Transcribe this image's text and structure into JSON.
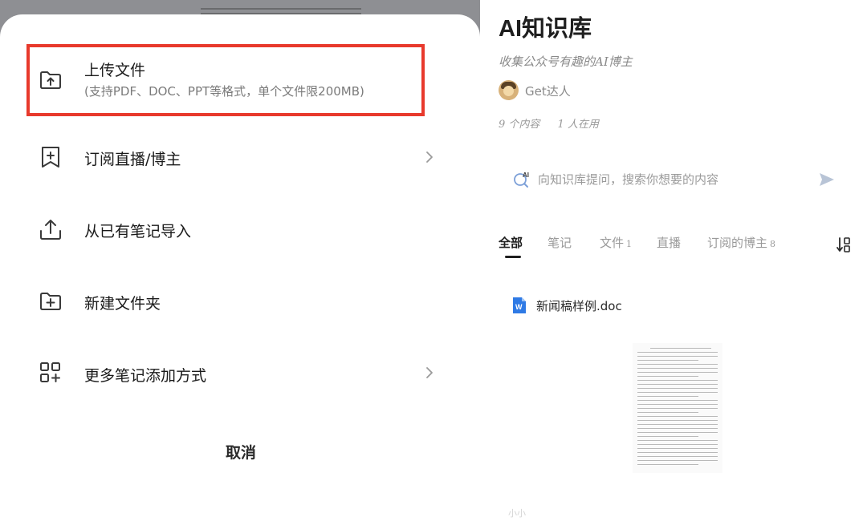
{
  "upload_sheet": {
    "items": [
      {
        "label": "上传文件",
        "sublabel": "(支持PDF、DOC、PPT等格式，单个文件限200MB)",
        "icon": "upload-folder-icon",
        "highlighted": true
      },
      {
        "label": "订阅直播/博主",
        "icon": "subscribe-bookmark-icon",
        "has_chevron": true
      },
      {
        "label": "从已有笔记导入",
        "icon": "import-upload-icon"
      },
      {
        "label": "新建文件夹",
        "icon": "new-folder-icon"
      },
      {
        "label": "更多笔记添加方式",
        "icon": "grid-add-icon",
        "has_chevron": true
      }
    ],
    "cancel_label": "取消",
    "highlight_color": "#e8392c"
  },
  "knowledge_base": {
    "title": "AI知识库",
    "description": "收集公众号有趣的AI博主",
    "author": {
      "name": "Get达人",
      "avatar_icon": "avatar"
    },
    "stats": {
      "contents": "9 个内容",
      "users": "1 人在用"
    },
    "search": {
      "placeholder": "向知识库提问，搜索你想要的内容"
    },
    "tabs": [
      {
        "label": "全部",
        "count": "",
        "active": true
      },
      {
        "label": "笔记",
        "count": ""
      },
      {
        "label": "文件",
        "count": "1"
      },
      {
        "label": "直播",
        "count": ""
      },
      {
        "label": "订阅的博主",
        "count": "8"
      }
    ],
    "files": [
      {
        "name": "新闻稿样例.doc",
        "icon": "word-doc-icon"
      }
    ],
    "watermark": "小小"
  }
}
